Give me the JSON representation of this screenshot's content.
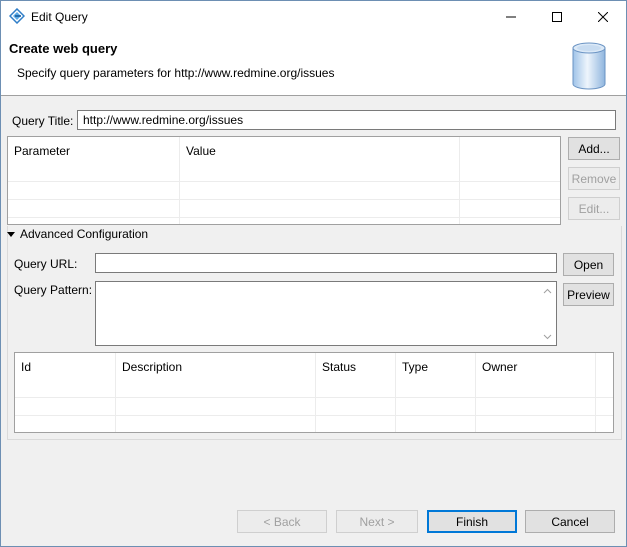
{
  "window": {
    "title": "Edit Query",
    "controls": {
      "minimize": "—",
      "maximize": "☐",
      "close": "✕"
    }
  },
  "header": {
    "title": "Create web query",
    "description": "Specify query parameters for http://www.redmine.org/issues"
  },
  "query_title": {
    "label": "Query Title:",
    "value": "http://www.redmine.org/issues"
  },
  "params_table": {
    "columns": [
      "Parameter",
      "Value",
      ""
    ],
    "rows": []
  },
  "params_buttons": {
    "add": "Add...",
    "remove": "Remove",
    "edit": "Edit..."
  },
  "advanced": {
    "label": "Advanced Configuration",
    "expanded": true,
    "query_url": {
      "label": "Query URL:",
      "value": ""
    },
    "open_button": "Open",
    "query_pattern": {
      "label": "Query Pattern:",
      "value": ""
    },
    "preview_button": "Preview",
    "results_table": {
      "columns": [
        "Id",
        "Description",
        "Status",
        "Type",
        "Owner",
        ""
      ],
      "rows": []
    }
  },
  "footer": {
    "back": "< Back",
    "next": "Next >",
    "finish": "Finish",
    "cancel": "Cancel"
  }
}
